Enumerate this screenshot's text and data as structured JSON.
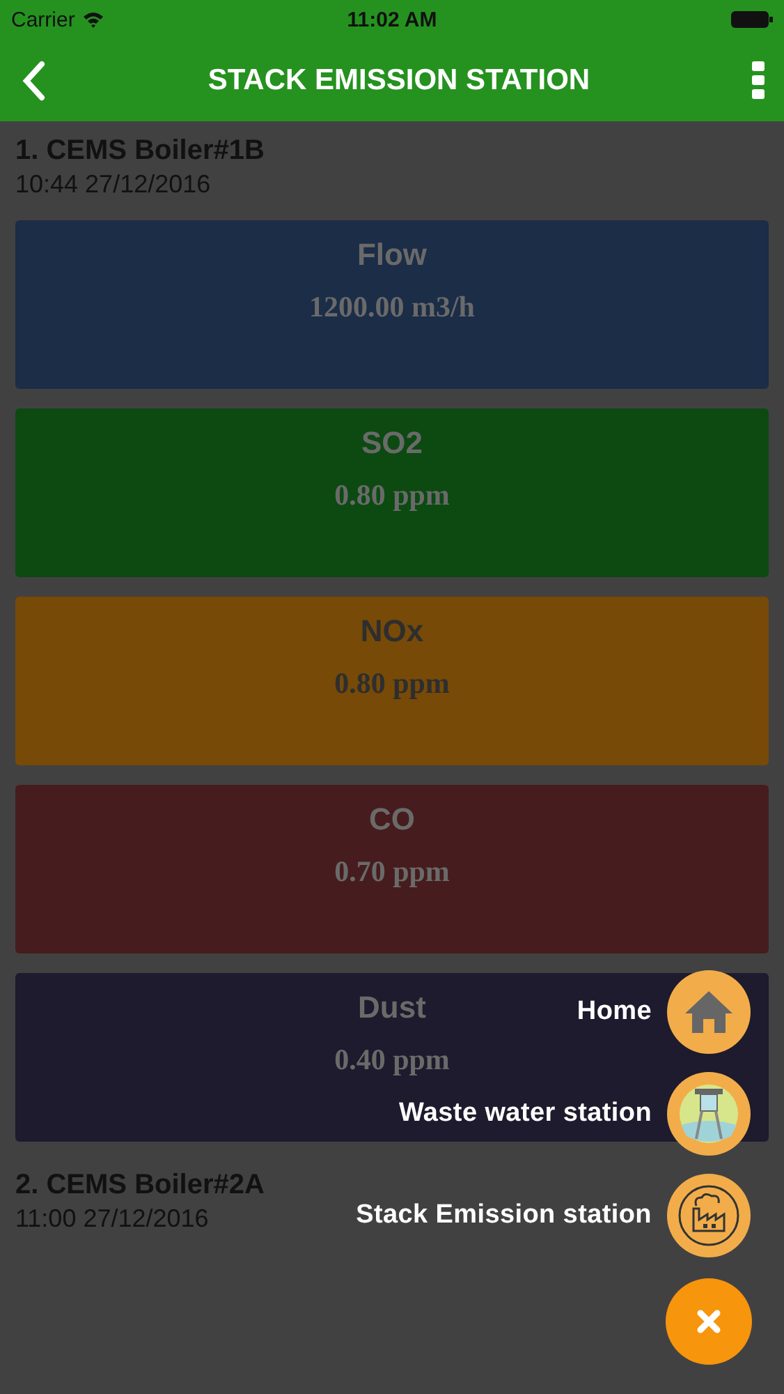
{
  "status_bar": {
    "carrier": "Carrier",
    "time": "11:02 AM"
  },
  "header": {
    "title": "STACK EMISSION STATION"
  },
  "stations": [
    {
      "name": "1. CEMS Boiler#1B",
      "timestamp": "10:44 27/12/2016",
      "readings": [
        {
          "label": "Flow",
          "value": "1200.00 m3/h",
          "color": "#1b2d47"
        },
        {
          "label": "SO2",
          "value": "0.80 ppm",
          "color": "#0c4a12"
        },
        {
          "label": "NOx",
          "value": "0.80 ppm",
          "color": "#774a08"
        },
        {
          "label": "CO",
          "value": "0.70 ppm",
          "color": "#471c1e"
        },
        {
          "label": "Dust",
          "value": "0.40 ppm",
          "color": "#1d1b2d"
        }
      ]
    },
    {
      "name": "2. CEMS Boiler#2A",
      "timestamp": "11:00 27/12/2016"
    }
  ],
  "fab_menu": {
    "items": [
      {
        "kind": "home",
        "label": "Home"
      },
      {
        "kind": "water",
        "label": "Waste water station"
      },
      {
        "kind": "stack",
        "label": "Stack Emission station"
      }
    ]
  }
}
